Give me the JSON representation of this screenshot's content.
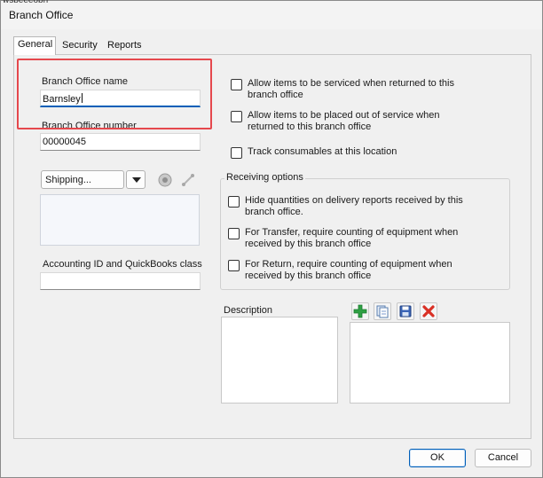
{
  "window": {
    "partial_text": "wsbeeeobh",
    "title": "Branch Office"
  },
  "tabs": [
    {
      "label": "General"
    },
    {
      "label": "Security"
    },
    {
      "label": "Reports"
    }
  ],
  "general": {
    "name_label": "Branch Office name",
    "name_value": "Barnsley",
    "number_label": "Branch Office number",
    "number_value": "00000045",
    "address_type": "Shipping...",
    "address_text": "",
    "accounting_label": "Accounting ID and QuickBooks class",
    "accounting_value": ""
  },
  "options": [
    {
      "label": "Allow items to be serviced when returned to this branch office",
      "checked": false
    },
    {
      "label": "Allow items to be placed out of service when returned to this branch office",
      "checked": false
    },
    {
      "label": "Track consumables at this location",
      "checked": false
    }
  ],
  "receiving": {
    "title": "Receiving options",
    "items": [
      {
        "label": "Hide quantities on delivery reports received by this branch office.",
        "checked": false
      },
      {
        "label": "For Transfer, require counting of equipment when received by this branch office",
        "checked": false
      },
      {
        "label": "For Return, require counting of equipment when received by this branch office",
        "checked": false
      }
    ]
  },
  "description": {
    "label": "Description",
    "value": ""
  },
  "icons": {
    "globe": "globe-icon",
    "link": "link-icon",
    "add": "add-icon",
    "copy": "copy-icon",
    "save": "save-icon",
    "delete": "delete-icon"
  },
  "colors": {
    "highlight": "#e5484d",
    "focus": "#005fb8",
    "add": "#2ea043",
    "delete": "#d93025"
  },
  "buttons": {
    "ok": "OK",
    "cancel": "Cancel"
  }
}
